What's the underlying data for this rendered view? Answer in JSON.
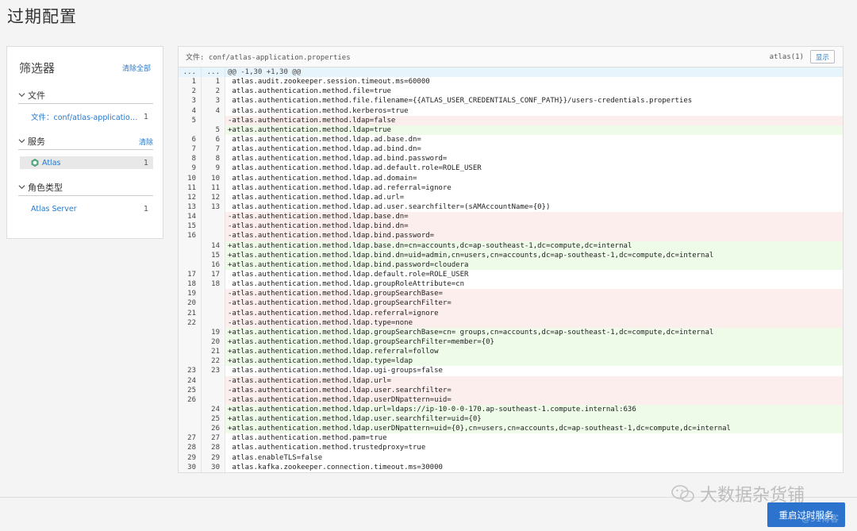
{
  "page": {
    "title": "过期配置"
  },
  "filter": {
    "header": "筛选器",
    "clear_all": "清除全部",
    "groups": [
      {
        "title": "文件",
        "clear": "",
        "items": [
          {
            "label": "文件：conf/atlas-application.properties",
            "count": "1"
          }
        ]
      },
      {
        "title": "服务",
        "clear": "清除",
        "items": [
          {
            "label": "Atlas",
            "count": "1",
            "icon": "atlas-hex-icon"
          }
        ]
      },
      {
        "title": "角色类型",
        "clear": "",
        "items": [
          {
            "label": "Atlas Server",
            "count": "1"
          }
        ]
      }
    ]
  },
  "diff": {
    "file_label": "文件: conf/atlas-application.properties",
    "host_label": "atlas(1)",
    "show_button": "显示",
    "lines": [
      {
        "type": "hunk",
        "old": "...",
        "new": "...",
        "text": "@@ -1,30 +1,30 @@"
      },
      {
        "type": "ctx",
        "old": "1",
        "new": "1",
        "text": " atlas.audit.zookeeper.session.timeout.ms=60000"
      },
      {
        "type": "ctx",
        "old": "2",
        "new": "2",
        "text": " atlas.authentication.method.file=true"
      },
      {
        "type": "ctx",
        "old": "3",
        "new": "3",
        "text": " atlas.authentication.method.file.filename={{ATLAS_USER_CREDENTIALS_CONF_PATH}}/users-credentials.properties"
      },
      {
        "type": "ctx",
        "old": "4",
        "new": "4",
        "text": " atlas.authentication.method.kerberos=true"
      },
      {
        "type": "del",
        "old": "5",
        "new": "",
        "text": "-atlas.authentication.method.ldap=false"
      },
      {
        "type": "add",
        "old": "",
        "new": "5",
        "text": "+atlas.authentication.method.ldap=true"
      },
      {
        "type": "ctx",
        "old": "6",
        "new": "6",
        "text": " atlas.authentication.method.ldap.ad.base.dn="
      },
      {
        "type": "ctx",
        "old": "7",
        "new": "7",
        "text": " atlas.authentication.method.ldap.ad.bind.dn="
      },
      {
        "type": "ctx",
        "old": "8",
        "new": "8",
        "text": " atlas.authentication.method.ldap.ad.bind.password="
      },
      {
        "type": "ctx",
        "old": "9",
        "new": "9",
        "text": " atlas.authentication.method.ldap.ad.default.role=ROLE_USER"
      },
      {
        "type": "ctx",
        "old": "10",
        "new": "10",
        "text": " atlas.authentication.method.ldap.ad.domain="
      },
      {
        "type": "ctx",
        "old": "11",
        "new": "11",
        "text": " atlas.authentication.method.ldap.ad.referral=ignore"
      },
      {
        "type": "ctx",
        "old": "12",
        "new": "12",
        "text": " atlas.authentication.method.ldap.ad.url="
      },
      {
        "type": "ctx",
        "old": "13",
        "new": "13",
        "text": " atlas.authentication.method.ldap.ad.user.searchfilter=(sAMAccountName={0})"
      },
      {
        "type": "del",
        "old": "14",
        "new": "",
        "text": "-atlas.authentication.method.ldap.base.dn="
      },
      {
        "type": "del",
        "old": "15",
        "new": "",
        "text": "-atlas.authentication.method.ldap.bind.dn="
      },
      {
        "type": "del",
        "old": "16",
        "new": "",
        "text": "-atlas.authentication.method.ldap.bind.password="
      },
      {
        "type": "add",
        "old": "",
        "new": "14",
        "text": "+atlas.authentication.method.ldap.base.dn=cn=accounts,dc=ap-southeast-1,dc=compute,dc=internal"
      },
      {
        "type": "add",
        "old": "",
        "new": "15",
        "text": "+atlas.authentication.method.ldap.bind.dn=uid=admin,cn=users,cn=accounts,dc=ap-southeast-1,dc=compute,dc=internal"
      },
      {
        "type": "add",
        "old": "",
        "new": "16",
        "text": "+atlas.authentication.method.ldap.bind.password=cloudera"
      },
      {
        "type": "ctx",
        "old": "17",
        "new": "17",
        "text": " atlas.authentication.method.ldap.default.role=ROLE_USER"
      },
      {
        "type": "ctx",
        "old": "18",
        "new": "18",
        "text": " atlas.authentication.method.ldap.groupRoleAttribute=cn"
      },
      {
        "type": "del",
        "old": "19",
        "new": "",
        "text": "-atlas.authentication.method.ldap.groupSearchBase="
      },
      {
        "type": "del",
        "old": "20",
        "new": "",
        "text": "-atlas.authentication.method.ldap.groupSearchFilter="
      },
      {
        "type": "del",
        "old": "21",
        "new": "",
        "text": "-atlas.authentication.method.ldap.referral=ignore"
      },
      {
        "type": "del",
        "old": "22",
        "new": "",
        "text": "-atlas.authentication.method.ldap.type=none"
      },
      {
        "type": "add",
        "old": "",
        "new": "19",
        "text": "+atlas.authentication.method.ldap.groupSearchBase=cn= groups,cn=accounts,dc=ap-southeast-1,dc=compute,dc=internal"
      },
      {
        "type": "add",
        "old": "",
        "new": "20",
        "text": "+atlas.authentication.method.ldap.groupSearchFilter=member={0}"
      },
      {
        "type": "add",
        "old": "",
        "new": "21",
        "text": "+atlas.authentication.method.ldap.referral=follow"
      },
      {
        "type": "add",
        "old": "",
        "new": "22",
        "text": "+atlas.authentication.method.ldap.type=ldap"
      },
      {
        "type": "ctx",
        "old": "23",
        "new": "23",
        "text": " atlas.authentication.method.ldap.ugi-groups=false"
      },
      {
        "type": "del",
        "old": "24",
        "new": "",
        "text": "-atlas.authentication.method.ldap.url="
      },
      {
        "type": "del",
        "old": "25",
        "new": "",
        "text": "-atlas.authentication.method.ldap.user.searchfilter="
      },
      {
        "type": "del",
        "old": "26",
        "new": "",
        "text": "-atlas.authentication.method.ldap.userDNpattern=uid="
      },
      {
        "type": "add",
        "old": "",
        "new": "24",
        "text": "+atlas.authentication.method.ldap.url=ldaps://ip-10-0-0-170.ap-southeast-1.compute.internal:636"
      },
      {
        "type": "add",
        "old": "",
        "new": "25",
        "text": "+atlas.authentication.method.ldap.user.searchfilter=uid={0}"
      },
      {
        "type": "add",
        "old": "",
        "new": "26",
        "text": "+atlas.authentication.method.ldap.userDNpattern=uid={0},cn=users,cn=accounts,dc=ap-southeast-1,dc=compute,dc=internal"
      },
      {
        "type": "ctx",
        "old": "27",
        "new": "27",
        "text": " atlas.authentication.method.pam=true"
      },
      {
        "type": "ctx",
        "old": "28",
        "new": "28",
        "text": " atlas.authentication.method.trustedproxy=true"
      },
      {
        "type": "ctx",
        "old": "29",
        "new": "29",
        "text": " atlas.enableTLS=false"
      },
      {
        "type": "ctx",
        "old": "30",
        "new": "30",
        "text": " atlas.kafka.zookeeper.connection.timeout.ms=30000"
      }
    ]
  },
  "footer": {
    "watermark": "大数据杂货铺",
    "restart_button": "重启过时服务",
    "watermark_small": "@51博客"
  },
  "colors": {
    "accent": "#2878c8",
    "button": "#2b73cc",
    "del_bg": "#fdeeee",
    "add_bg": "#eefbe9",
    "hunk_bg": "#e8f4fb"
  }
}
